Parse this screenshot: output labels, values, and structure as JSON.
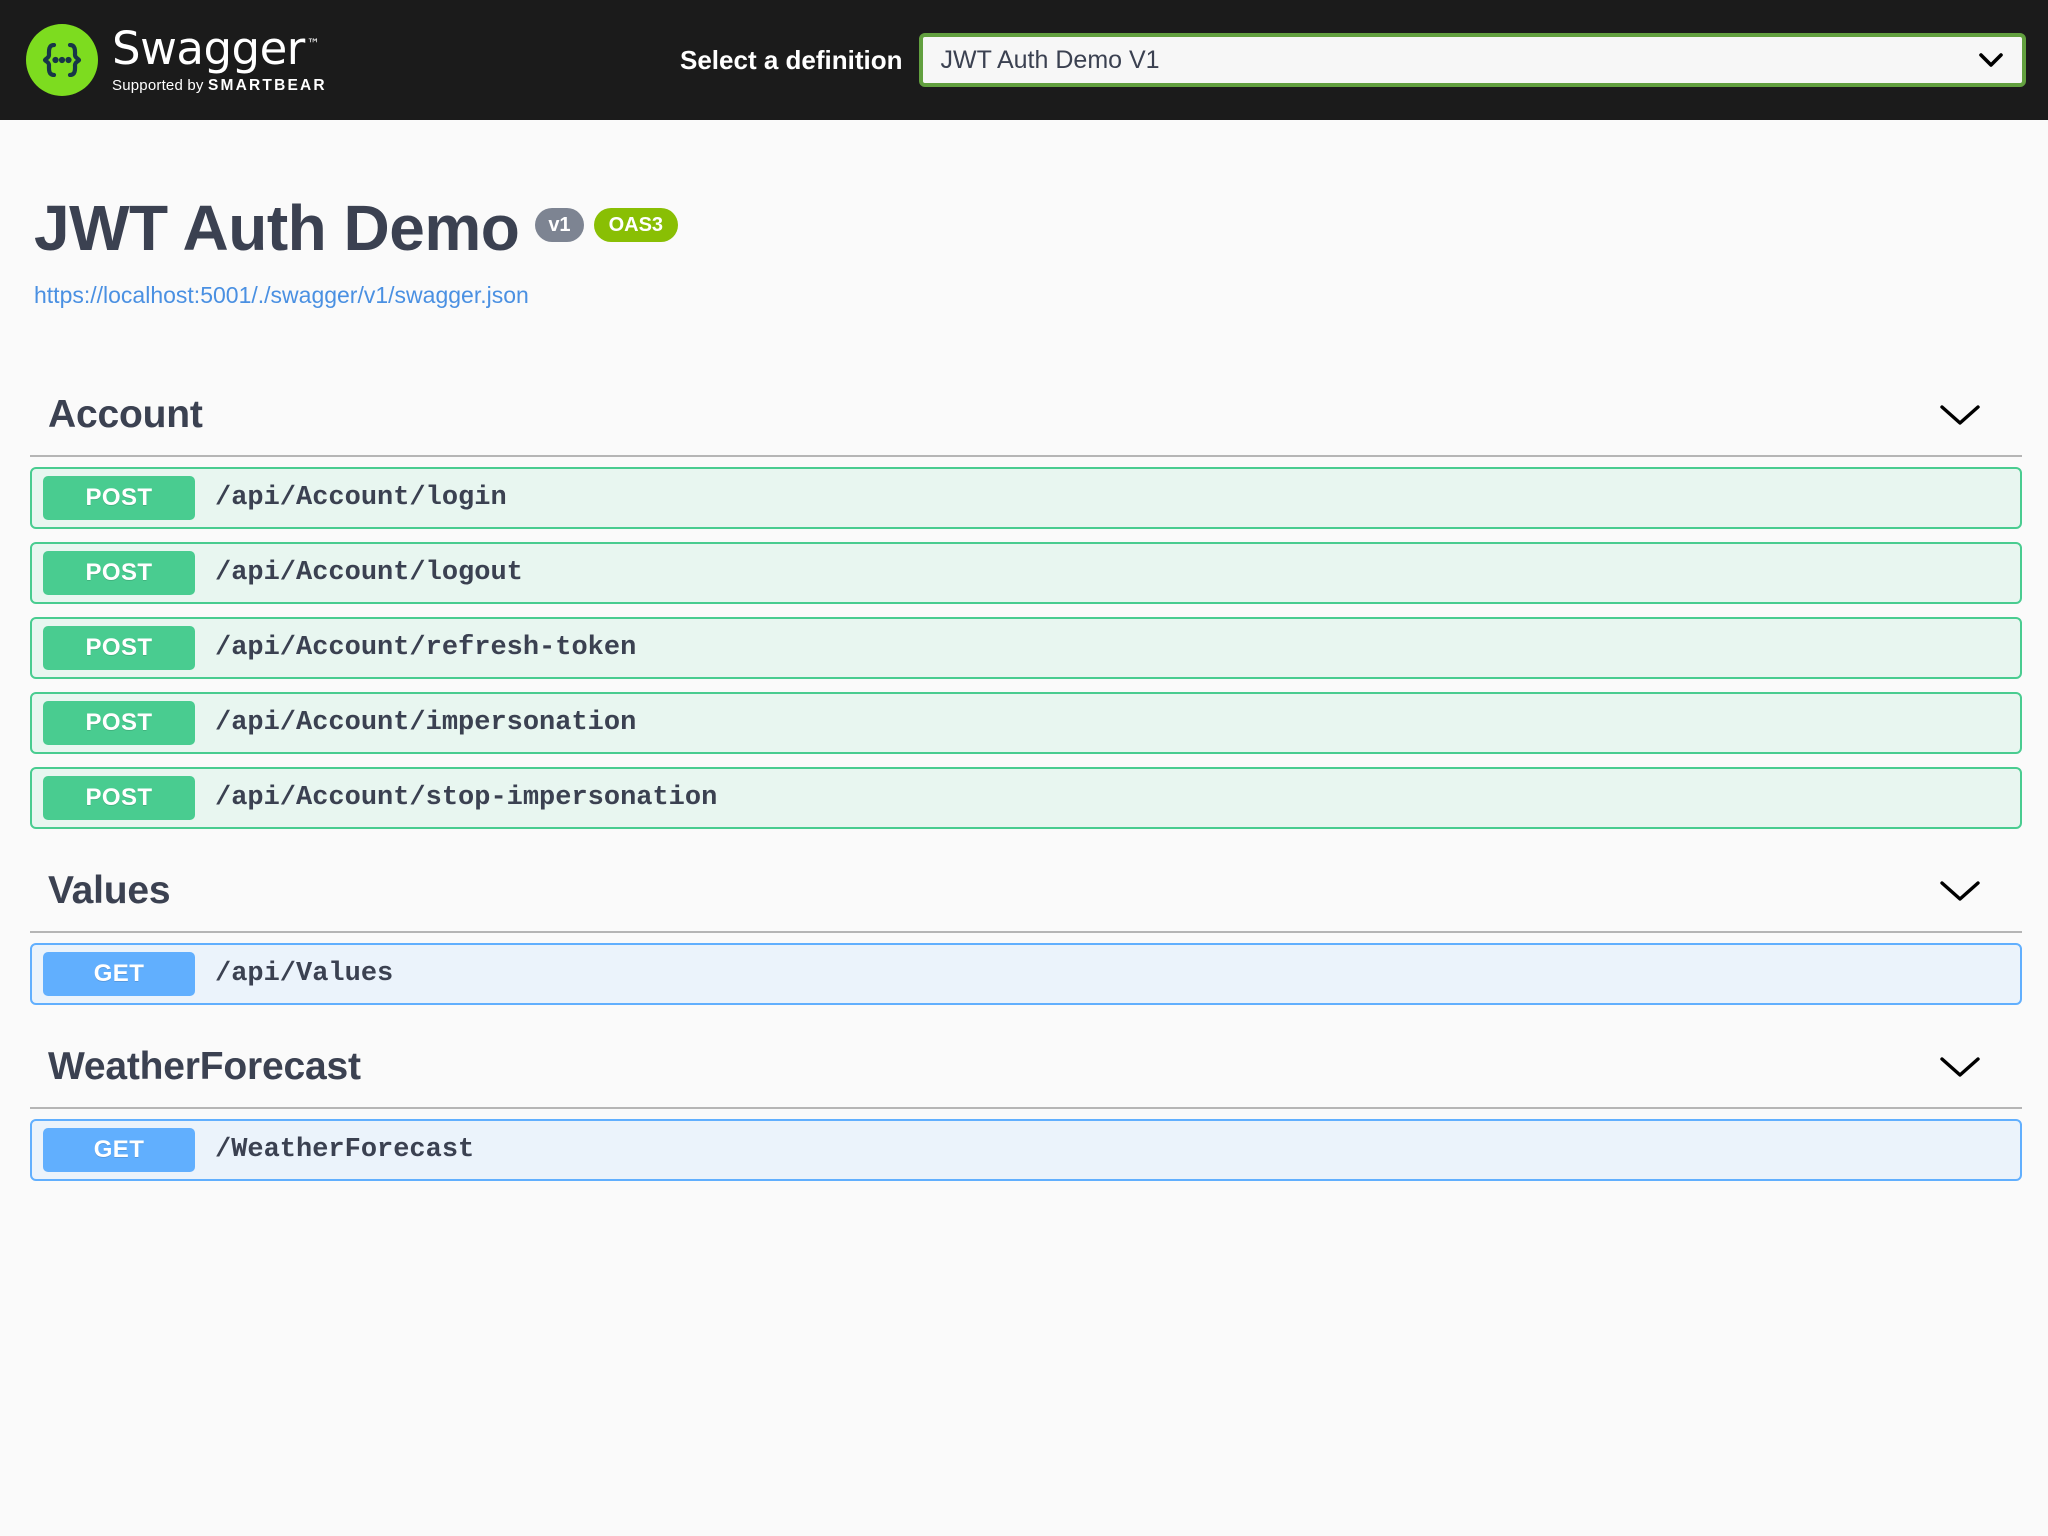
{
  "topbar": {
    "logo_icon": "swagger-braces-logo-icon",
    "brand_name": "Swagger",
    "brand_tm": "™",
    "brand_supported_prefix": "Supported by ",
    "brand_supported_company": "SMARTBEAR",
    "select_label": "Select a definition",
    "definition_value": "JWT Auth Demo V1",
    "definition_options": [
      "JWT Auth Demo V1"
    ],
    "dropdown_icon": "chevron-down-icon",
    "background_color": "#1b1b1b",
    "select_border_color": "#62a03f"
  },
  "info": {
    "title": "JWT Auth Demo",
    "version_badge": "v1",
    "spec_badge": "OAS3",
    "url": "https://localhost:5001/./swagger/v1/swagger.json",
    "version_badge_color": "#7d8492",
    "spec_badge_color": "#89bf04",
    "url_color": "#4a90e2"
  },
  "colors": {
    "post": "#49cc90",
    "post_bg": "#e8f6f0",
    "get": "#61affe",
    "get_bg": "#ebf3fb",
    "text": "#3b4151",
    "page_bg": "#fafafa"
  },
  "sections": [
    {
      "name": "Account",
      "toggle_icon": "chevron-down-icon",
      "operations": [
        {
          "method": "POST",
          "path": "/api/Account/login"
        },
        {
          "method": "POST",
          "path": "/api/Account/logout"
        },
        {
          "method": "POST",
          "path": "/api/Account/refresh-token"
        },
        {
          "method": "POST",
          "path": "/api/Account/impersonation"
        },
        {
          "method": "POST",
          "path": "/api/Account/stop-impersonation"
        }
      ]
    },
    {
      "name": "Values",
      "toggle_icon": "chevron-down-icon",
      "operations": [
        {
          "method": "GET",
          "path": "/api/Values"
        }
      ]
    },
    {
      "name": "WeatherForecast",
      "toggle_icon": "chevron-down-icon",
      "operations": [
        {
          "method": "GET",
          "path": "/WeatherForecast"
        }
      ]
    }
  ]
}
